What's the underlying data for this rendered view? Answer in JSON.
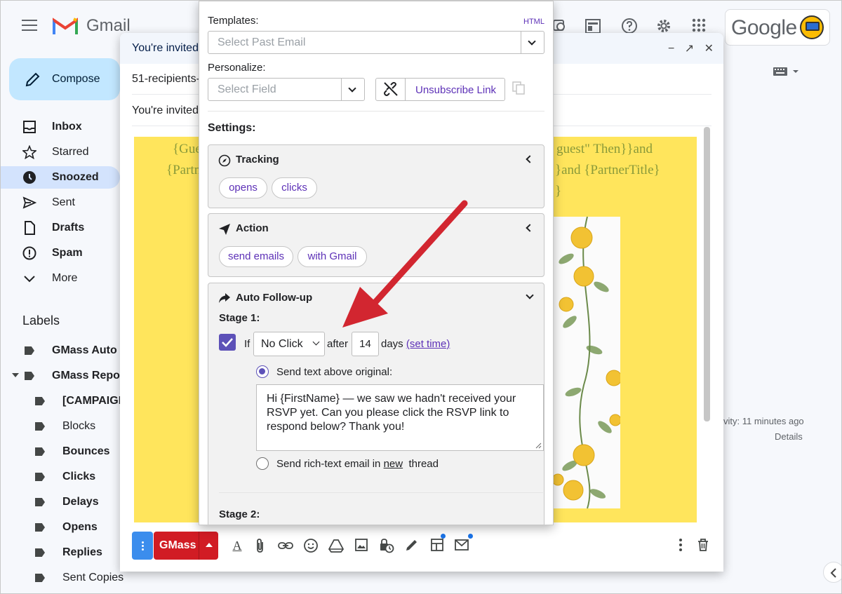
{
  "gmail": {
    "title": "Gmail",
    "google_word": "Google"
  },
  "sidebar": {
    "compose_label": "Compose",
    "nav": [
      {
        "label": "Inbox"
      },
      {
        "label": "Starred"
      },
      {
        "label": "Snoozed"
      },
      {
        "label": "Sent"
      },
      {
        "label": "Drafts"
      },
      {
        "label": "Spam"
      },
      {
        "label": "More"
      }
    ],
    "labels_title": "Labels",
    "labels": [
      {
        "label": "GMass Auto F"
      },
      {
        "label": "GMass Repor"
      },
      {
        "label": "[CAMPAIGN"
      },
      {
        "label": "Blocks"
      },
      {
        "label": "Bounces"
      },
      {
        "label": "Clicks"
      },
      {
        "label": "Delays"
      },
      {
        "label": "Opens"
      },
      {
        "label": "Replies"
      },
      {
        "label": "Sent Copies"
      }
    ]
  },
  "right": {
    "activity": "vity: 11 minutes ago",
    "details": "Details"
  },
  "compose": {
    "title": "You're invited",
    "recipients": "51-recipients-",
    "subject": "You're invited",
    "body_lines": {
      "l1_left": "{Gue",
      "l2_left": "{Partn",
      "l1_right": "guest\" Then}}and",
      "l2_right": "}and {PartnerTitle}",
      "l3_right": "}"
    },
    "gmass_label": "GMass"
  },
  "gmass_panel": {
    "templates_label": "Templates:",
    "html_link": "HTML",
    "templates_placeholder": "Select Past Email",
    "personalize_label": "Personalize:",
    "personalize_placeholder": "Select Field",
    "unsubscribe_label": "Unsubscribe Link",
    "settings_label": "Settings:",
    "tracking": {
      "title": "Tracking",
      "pills": [
        "opens",
        "clicks"
      ]
    },
    "action": {
      "title": "Action",
      "pills": [
        "send emails",
        "with Gmail"
      ]
    },
    "followup": {
      "title": "Auto Follow-up",
      "stage1_label": "Stage 1:",
      "if_label": "If",
      "condition": "No Click",
      "after_label": "after",
      "days_value": "14",
      "days_label": "days",
      "set_time": "(set time)",
      "send_above_label": "Send text above original:",
      "message": "Hi {FirstName} — we saw we hadn't received your RSVP yet. Can you please click the RSVP link to respond below? Thank you!",
      "send_rich_prefix": "Send rich-text email in",
      "send_rich_new": "new",
      "send_rich_suffix": "thread",
      "stage2_label": "Stage 2:"
    }
  },
  "colors": {
    "accent_purple": "#5d31b7",
    "gmass_red": "#d11c24",
    "arrow_red": "#d22630",
    "body_yellow": "#ffe55c"
  }
}
